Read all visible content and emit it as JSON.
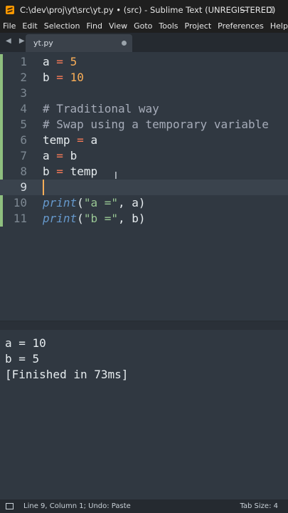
{
  "window": {
    "title": "C:\\dev\\proj\\yt\\src\\yt.py • (src) - Sublime Text (UNREGISTERED)",
    "minimize": "—",
    "maximize": "☐"
  },
  "menu": [
    "File",
    "Edit",
    "Selection",
    "Find",
    "View",
    "Goto",
    "Tools",
    "Project",
    "Preferences",
    "Help"
  ],
  "tabs": {
    "nav": "◀ ▶",
    "active": {
      "label": "yt.py",
      "dirty": true
    }
  },
  "editor": {
    "current_line": 9,
    "lines": [
      {
        "num": "1",
        "tokens": [
          [
            "a",
            "var"
          ],
          [
            " ",
            ""
          ],
          [
            "=",
            "op"
          ],
          [
            " ",
            ""
          ],
          [
            "5",
            "num"
          ]
        ]
      },
      {
        "num": "2",
        "tokens": [
          [
            "b",
            "var"
          ],
          [
            " ",
            ""
          ],
          [
            "=",
            "op"
          ],
          [
            " ",
            ""
          ],
          [
            "10",
            "num"
          ]
        ]
      },
      {
        "num": "3",
        "tokens": []
      },
      {
        "num": "4",
        "tokens": [
          [
            "# Traditional way",
            "cmt"
          ]
        ]
      },
      {
        "num": "5",
        "tokens": [
          [
            "# Swap using a temporary variable",
            "cmt"
          ]
        ]
      },
      {
        "num": "6",
        "tokens": [
          [
            "temp",
            "var"
          ],
          [
            " ",
            ""
          ],
          [
            "=",
            "op"
          ],
          [
            " ",
            ""
          ],
          [
            "a",
            "var"
          ]
        ]
      },
      {
        "num": "7",
        "tokens": [
          [
            "a",
            "var"
          ],
          [
            " ",
            ""
          ],
          [
            "=",
            "op"
          ],
          [
            " ",
            ""
          ],
          [
            "b",
            "var"
          ]
        ]
      },
      {
        "num": "8",
        "tokens": [
          [
            "b",
            "var"
          ],
          [
            " ",
            ""
          ],
          [
            "=",
            "op"
          ],
          [
            " ",
            ""
          ],
          [
            "temp",
            "var"
          ]
        ]
      },
      {
        "num": "9",
        "tokens": []
      },
      {
        "num": "10",
        "tokens": [
          [
            "print",
            "fn"
          ],
          [
            "(",
            "punc"
          ],
          [
            "\"a =\"",
            "str"
          ],
          [
            ", a)",
            "punc"
          ]
        ]
      },
      {
        "num": "11",
        "tokens": [
          [
            "print",
            "fn"
          ],
          [
            "(",
            "punc"
          ],
          [
            "\"b =\"",
            "str"
          ],
          [
            ", b)",
            "punc"
          ]
        ]
      }
    ]
  },
  "output": {
    "lines": [
      "a = 10",
      "b = 5",
      "[Finished in 73ms]"
    ]
  },
  "status": {
    "position": "Line 9, Column 1; Undo: Paste",
    "tab_size": "Tab Size: 4"
  },
  "colors": {
    "background": "#303841",
    "chrome": "#1f1f1f",
    "keyword_operator": "#f97b58",
    "number": "#f9ae58",
    "function": "#6699cc",
    "string": "#99c794",
    "comment": "#a6acb9",
    "modified_gutter": "#8fbf7f"
  }
}
